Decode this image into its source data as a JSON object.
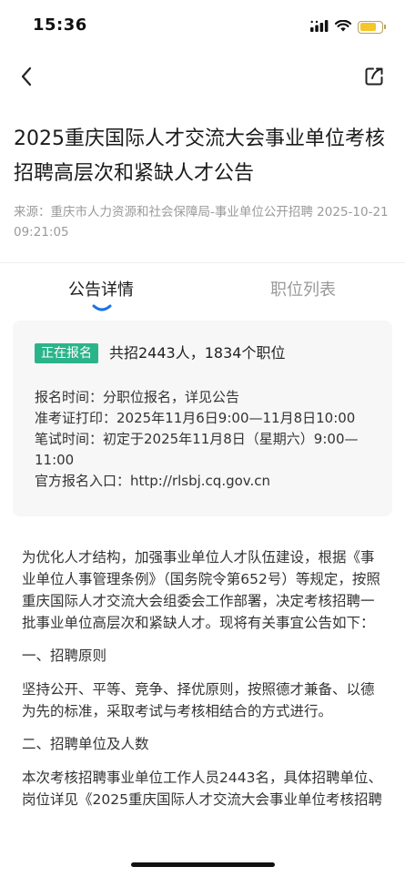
{
  "status_bar": {
    "time": "15:36",
    "icons": [
      "signal-icon",
      "wifi-icon",
      "battery-icon"
    ],
    "battery_level": 0.75,
    "battery_color": "#f4c62b"
  },
  "nav": {
    "back_icon": "chevron-left-icon",
    "share_icon": "share-icon"
  },
  "article": {
    "title": "2025重庆国际人才交流大会事业单位考核招聘高层次和紧缺人才公告",
    "source_label": "来源：",
    "source": "重庆市人力资源和社会保障局-事业单位公开招聘",
    "datetime": "2025-10-21 09:21:05"
  },
  "tabs": [
    {
      "label": "公告详情",
      "active": true
    },
    {
      "label": "职位列表",
      "active": false
    }
  ],
  "card": {
    "badge": "正在报名",
    "badge_color": "#2bb48a",
    "summary": "共招2443人，1834个职位",
    "lines": [
      "报名时间：分职位报名，详见公告",
      "准考证打印：2025年11月6日9:00—11月8日10:00",
      "笔试时间：初定于2025年11月8日（星期六）9:00—11:00",
      "官方报名入口：http://rlsbj.cq.gov.cn"
    ]
  },
  "content": {
    "intro": "为优化人才结构，加强事业单位人才队伍建设，根据《事业单位人事管理条例》（国务院令第652号）等规定，按照重庆国际人才交流大会组委会工作部署，决定考核招聘一批事业单位高层次和紧缺人才。现将有关事宜公告如下：",
    "section1_heading": "一、招聘原则",
    "section1_text": "坚持公开、平等、竞争、择优原则，按照德才兼备、以德为先的标准，采取考试与考核相结合的方式进行。",
    "section2_heading": "二、招聘单位及人数",
    "section2_text": "本次考核招聘事业单位工作人员2443名，具体招聘单位、岗位详见《2025重庆国际人才交流大会事业单位考核招聘"
  }
}
